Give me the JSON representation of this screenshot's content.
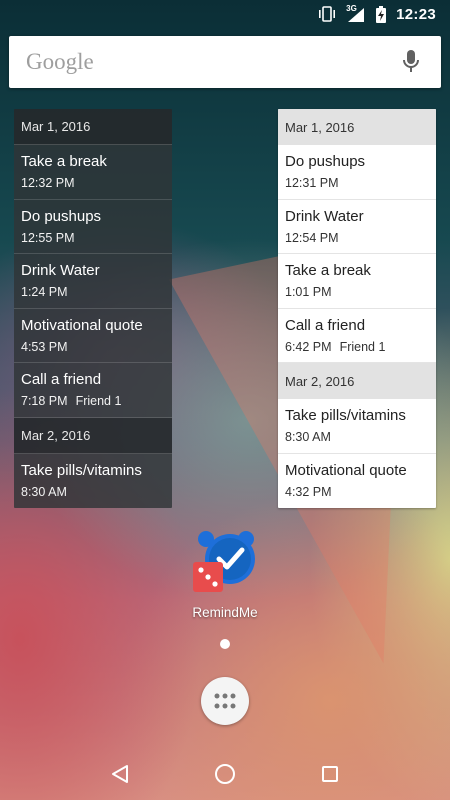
{
  "status_bar": {
    "network_label": "3G",
    "time": "12:23"
  },
  "search": {
    "logo_text": "Google",
    "icon": "mic-icon"
  },
  "widget_left": {
    "sections": [
      {
        "date": "Mar 1, 2016",
        "items": [
          {
            "title": "Take a break",
            "time": "12:32 PM",
            "contact": ""
          },
          {
            "title": "Do pushups",
            "time": "12:55 PM",
            "contact": ""
          },
          {
            "title": "Drink Water",
            "time": "1:24 PM",
            "contact": ""
          },
          {
            "title": "Motivational quote",
            "time": "4:53 PM",
            "contact": ""
          },
          {
            "title": "Call a friend",
            "time": "7:18 PM",
            "contact": "Friend 1"
          }
        ]
      },
      {
        "date": "Mar 2, 2016",
        "items": [
          {
            "title": "Take pills/vitamins",
            "time": "8:30 AM",
            "contact": ""
          }
        ]
      }
    ]
  },
  "widget_right": {
    "sections": [
      {
        "date": "Mar 1, 2016",
        "items": [
          {
            "title": "Do pushups",
            "time": "12:31 PM",
            "contact": ""
          },
          {
            "title": "Drink Water",
            "time": "12:54 PM",
            "contact": ""
          },
          {
            "title": "Take a break",
            "time": "1:01 PM",
            "contact": ""
          },
          {
            "title": "Call a friend",
            "time": "6:42 PM",
            "contact": "Friend 1"
          }
        ]
      },
      {
        "date": "Mar 2, 2016",
        "items": [
          {
            "title": "Take pills/vitamins",
            "time": "8:30 AM",
            "contact": ""
          },
          {
            "title": "Motivational quote",
            "time": "4:32 PM",
            "contact": ""
          }
        ]
      }
    ]
  },
  "home": {
    "app_name": "RemindMe",
    "app_icon": "alarm-clock-check-icon",
    "drawer_icon": "app-grid-icon"
  },
  "nav": {
    "back_icon": "back-triangle-icon",
    "home_icon": "home-circle-icon",
    "recents_icon": "recents-square-icon"
  },
  "colors": {
    "app_icon_blue": "#1e6fd9",
    "app_icon_red": "#e84c4c",
    "light_header": "#e2e2e2"
  }
}
